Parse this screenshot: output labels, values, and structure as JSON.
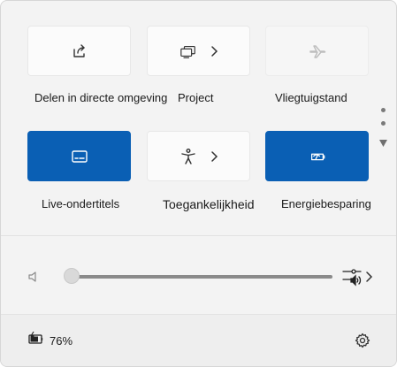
{
  "quick_settings": {
    "tiles": [
      {
        "label": "Delen in directe omgeving",
        "icon": "share-icon",
        "state": "off",
        "has_chevron": false
      },
      {
        "label": "Project",
        "icon": "project-display-icon",
        "state": "off",
        "has_chevron": true
      },
      {
        "label": "Vliegtuigstand",
        "icon": "airplane-icon",
        "state": "disabled",
        "has_chevron": false
      },
      {
        "label": "Live-ondertitels",
        "icon": "captions-icon",
        "state": "on",
        "has_chevron": false
      },
      {
        "label": "Toegankelijkheid",
        "icon": "accessibility-icon",
        "state": "off",
        "has_chevron": true
      },
      {
        "label": "Energiebesparing",
        "icon": "energy-saver-icon",
        "state": "on",
        "has_chevron": false
      }
    ]
  },
  "volume": {
    "level_percent": 0,
    "icon": "speaker-muted-icon",
    "output_icon": "audio-output-icon"
  },
  "footer": {
    "battery_percent_label": "76%",
    "battery_icon": "battery-charging-icon",
    "settings_icon": "gear-icon"
  },
  "colors": {
    "accent": "#0a5fb4",
    "panel_bg": "#f3f3f3",
    "tile_bg": "#fbfbfb"
  }
}
